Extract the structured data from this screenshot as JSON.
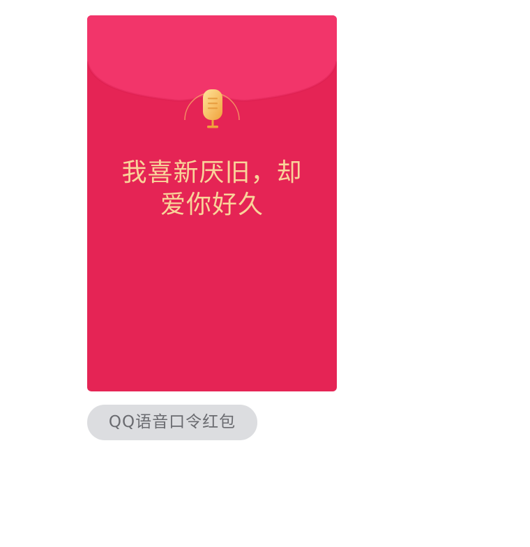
{
  "envelope": {
    "type": "voice-password",
    "message_line1": "我喜新厌旧，却",
    "message_line2": "爱你好久",
    "icon": "microphone-icon",
    "colors": {
      "body": "#e52455",
      "flap": "#f2356a",
      "text": "#f9d49a",
      "mic_gold": "#f5b44a"
    }
  },
  "caption": {
    "label": "QQ语音口令红包",
    "background": "#dcdde0"
  }
}
